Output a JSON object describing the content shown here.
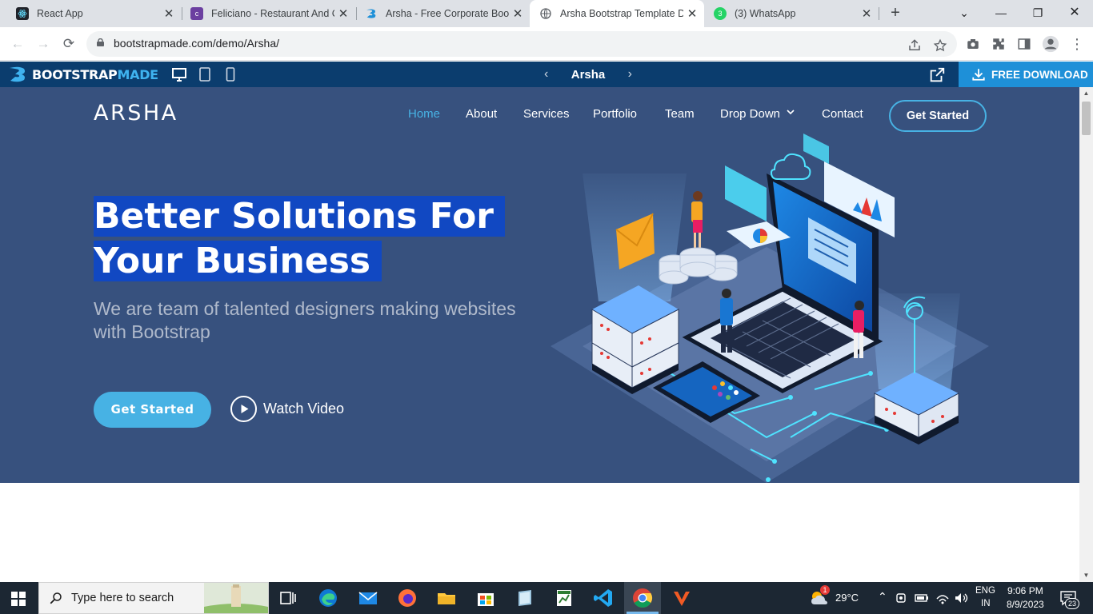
{
  "browser": {
    "tabs": [
      {
        "title": "React App",
        "favicon": "react-icon",
        "color": "#20232a"
      },
      {
        "title": "Feliciano - Restaurant And Ca",
        "favicon": "colorlib-icon",
        "color": "#6b3fa0"
      },
      {
        "title": "Arsha - Free Corporate Boots",
        "favicon": "bootstrapmade-icon",
        "color": "#1e90d8"
      },
      {
        "title": "Arsha Bootstrap Template De",
        "favicon": "globe-icon",
        "color": "#5f6368"
      },
      {
        "title": "(3) WhatsApp",
        "favicon": "whatsapp-icon",
        "color": "#25d366"
      }
    ],
    "active_tab": 3,
    "url": "bootstrapmade.com/demo/Arsha/"
  },
  "demo_bar": {
    "brand_part1": "BOOTSTRAP",
    "brand_part2": "MADE",
    "template_name": "Arsha",
    "download_label": "FREE DOWNLOAD"
  },
  "site": {
    "logo": "ARSHA",
    "nav": [
      "Home",
      "About",
      "Services",
      "Portfolio",
      "Team",
      "Drop Down",
      "Contact"
    ],
    "nav_active": "Home",
    "nav_cta": "Get Started",
    "hero": {
      "title_line1": "Better Solutions For",
      "title_line2": "Your Business",
      "subtitle": "We are team of talented designers making websites with Bootstrap",
      "primary_button": "Get Started",
      "video_link": "Watch Video"
    },
    "colors": {
      "hero_bg": "#37517e",
      "accent": "#47b2e4",
      "selection": "#1148c2"
    }
  },
  "taskbar": {
    "search_placeholder": "Type here to search",
    "weather": "29°C",
    "weather_badge": "1",
    "language_line1": "ENG",
    "language_line2": "IN",
    "time": "9:06 PM",
    "date": "8/9/2023",
    "notifications": "23"
  }
}
